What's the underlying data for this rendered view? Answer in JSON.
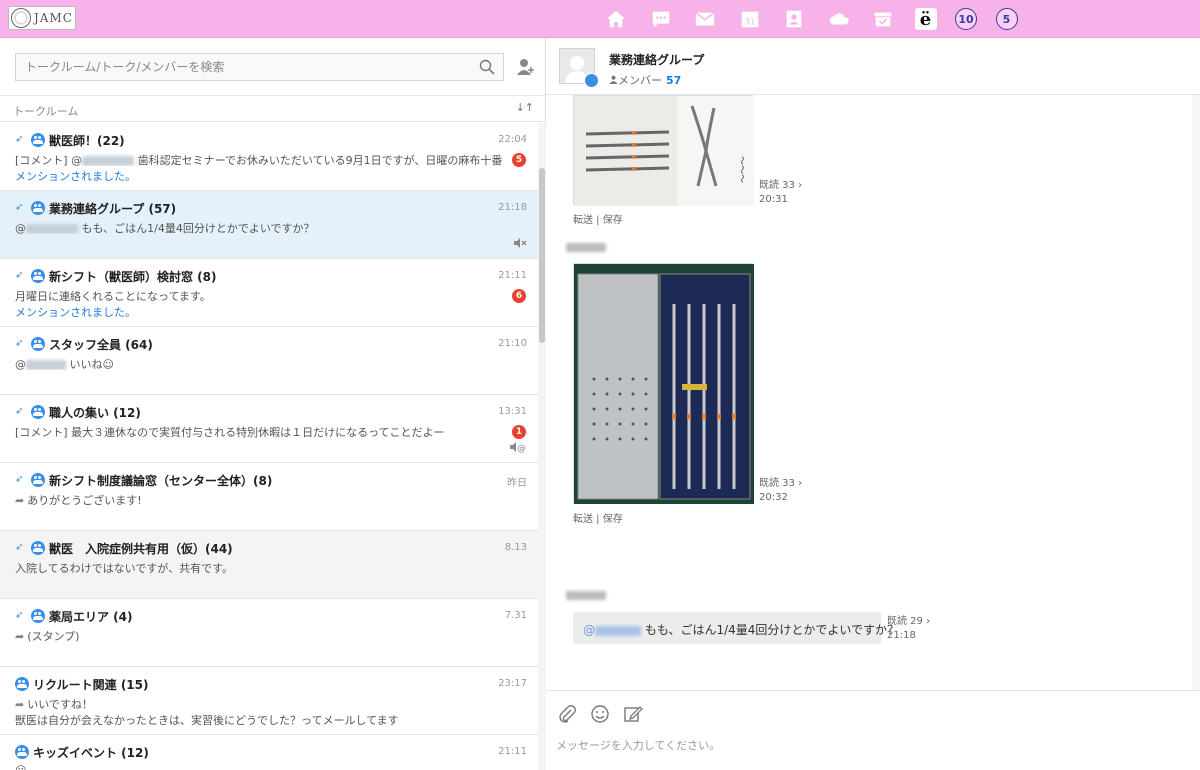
{
  "logo": {
    "text": "JAMC"
  },
  "nav": [
    {
      "name": "home-icon"
    },
    {
      "name": "chat-icon"
    },
    {
      "name": "mail-icon"
    },
    {
      "name": "calendar-icon",
      "text": "31"
    },
    {
      "name": "contacts-icon"
    },
    {
      "name": "cloud-icon"
    },
    {
      "name": "inbox-icon"
    },
    {
      "name": "e-app-icon",
      "text": "ë"
    },
    {
      "name": "app-10-icon",
      "text": "⑩"
    },
    {
      "name": "app-5-icon",
      "text": "⑤"
    }
  ],
  "search": {
    "placeholder": "トークルーム/トーク/メンバーを検索"
  },
  "list_header": {
    "label": "トークルーム",
    "sort": "↓↑"
  },
  "rooms": [
    {
      "title": "獣医師！(22)",
      "time": "22:04",
      "line1_prefix": "[コメント] @",
      "line1_suffix": " 歯科認定セミナーでお休みいただいている9月1日ですが、日曜の麻布十番",
      "line2": "メンションされました。",
      "unread": "5"
    },
    {
      "title": "業務連絡グループ (57)",
      "time": "21:18",
      "line1_prefix": "@",
      "line1_suffix": " もも、ごはん1/4量4回分けとかでよいですか？",
      "state": "🔇"
    },
    {
      "title": "新シフト（獣医師）検討窓 (8)",
      "time": "21:11",
      "line1_prefix": "月曜日に連絡くれることになってます。",
      "line2": "メンションされました。",
      "unread": "6"
    },
    {
      "title": "スタッフ全員 (64)",
      "time": "21:10",
      "line1_prefix": "@",
      "line1_suffix": " いいね☺"
    },
    {
      "title": "職人の集い (12)",
      "time": "13:31",
      "line1_prefix": "[コメント] 最大３連休なので実質付与される特別休暇は１日だけになるってことだよー",
      "unread": "1",
      "state": "🔇@"
    },
    {
      "title": "新シフト制度議論窓（センター全体）(8)",
      "time": "昨日",
      "line1_prefix": "ありがとうございます!"
    },
    {
      "title": "獣医　入院症例共有用（仮）(44)",
      "time": "8.13",
      "line1_prefix": "入院してるわけではないですが、共有です。"
    },
    {
      "title": "薬局エリア (4)",
      "time": "7.31",
      "line1_prefix": "(スタンプ)"
    },
    {
      "title": "リクルート関連 (15)",
      "time": "23:17",
      "line1_prefix": "いいですね！",
      "line2_plain": "獣医は自分が会えなかったときは、実習後にどうでした？ってメールしてます"
    },
    {
      "title": "キッズイベント (12)",
      "time": "21:11",
      "line1_prefix": "☺"
    }
  ],
  "chat": {
    "title": "業務連絡グループ",
    "members_label": "メンバー",
    "members_count": "57",
    "msg1": {
      "read": "既読 33 ›",
      "time": "20:31",
      "forward": "転送",
      "save": "保存"
    },
    "msg2": {
      "read": "既読 33 ›",
      "time": "20:32",
      "forward": "転送",
      "save": "保存"
    },
    "msg3": {
      "at": "@",
      "text": " もも、ごはん1/4量4回分けとかでよいですか？",
      "read": "既読 29 ›",
      "time": "21:18"
    }
  },
  "composer": {
    "placeholder": "メッセージを入力してください。"
  }
}
